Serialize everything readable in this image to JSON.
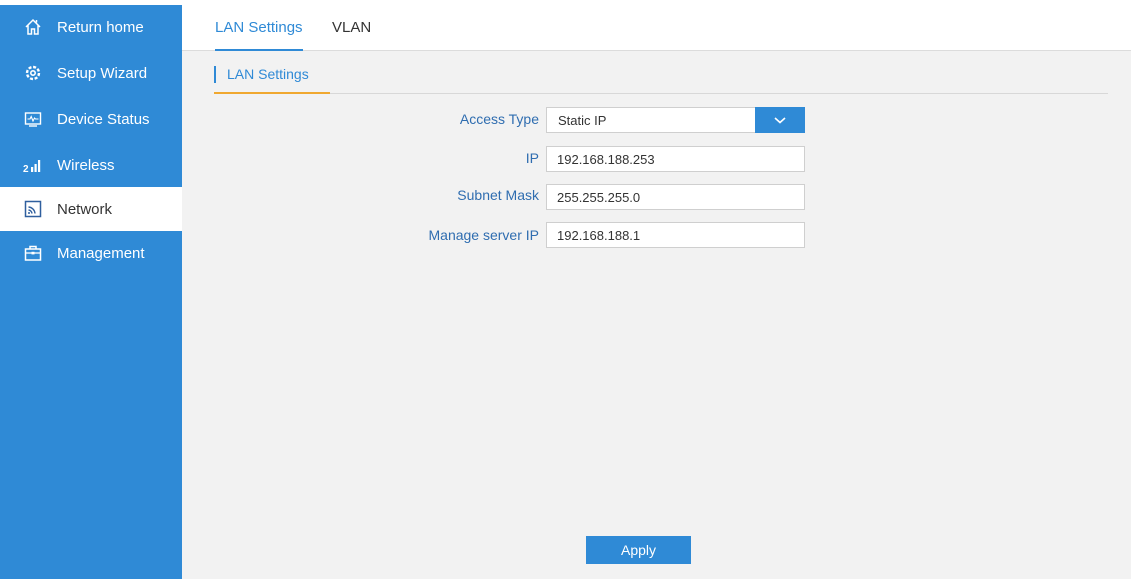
{
  "sidebar": {
    "items": [
      {
        "label": "Return home",
        "icon": "home-icon"
      },
      {
        "label": "Setup Wizard",
        "icon": "gear-icon"
      },
      {
        "label": "Device Status",
        "icon": "monitor-icon"
      },
      {
        "label": "Wireless",
        "icon": "signal-icon"
      },
      {
        "label": "Network",
        "icon": "network-icon"
      },
      {
        "label": "Management",
        "icon": "toolbox-icon"
      }
    ],
    "active": "Network"
  },
  "tabs": [
    {
      "label": "LAN Settings",
      "active": true
    },
    {
      "label": "VLAN",
      "active": false
    }
  ],
  "section": {
    "title": "LAN Settings"
  },
  "form": {
    "access_type": {
      "label": "Access Type",
      "value": "Static IP"
    },
    "ip": {
      "label": "IP",
      "value": "192.168.188.253"
    },
    "subnet_mask": {
      "label": "Subnet Mask",
      "value": "255.255.255.0"
    },
    "manage_server_ip": {
      "label": "Manage server IP",
      "value": "192.168.188.1"
    }
  },
  "apply_label": "Apply",
  "colors": {
    "accent": "#2f8ad6",
    "tab_underline_highlight": "#f0a830",
    "label_text": "#2f6db0",
    "background": "#f2f2f2"
  }
}
